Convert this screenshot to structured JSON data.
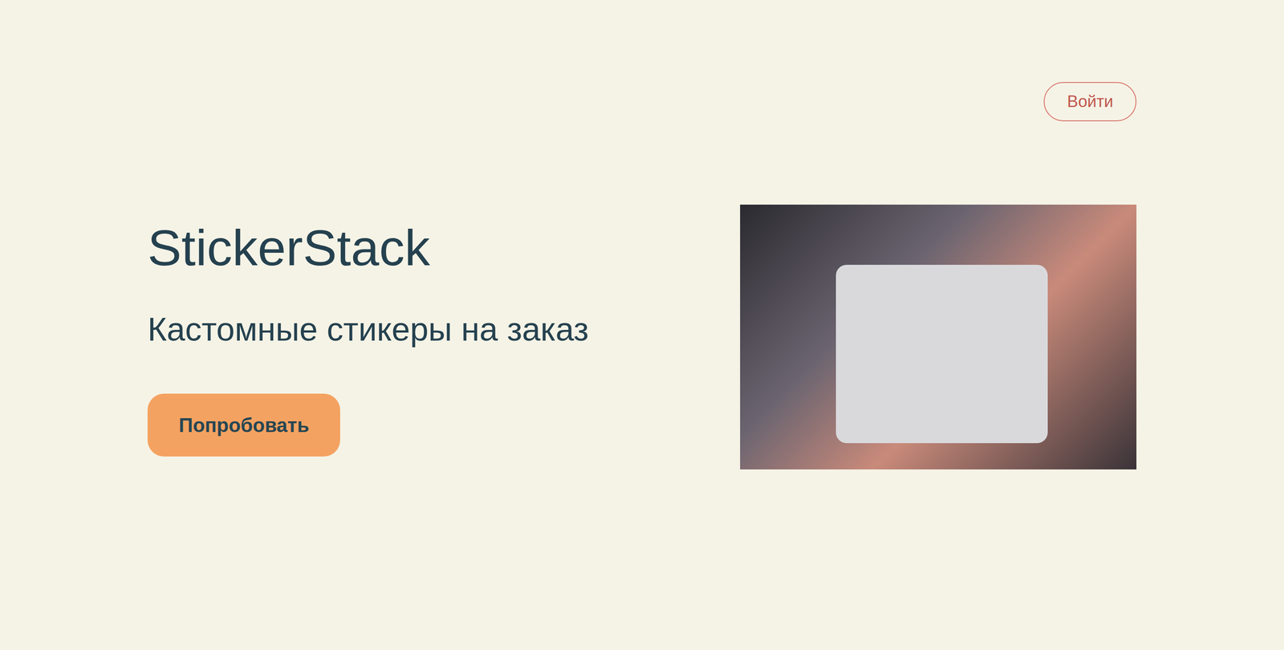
{
  "header": {
    "login": "Войти"
  },
  "hero": {
    "title": "StickerStack",
    "subtitle": "Кастомные стикеры на заказ",
    "cta": "Попробовать"
  }
}
